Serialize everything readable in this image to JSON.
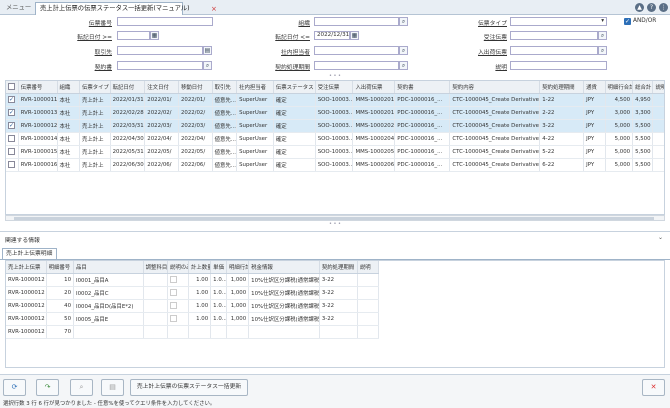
{
  "tabs": {
    "menu": "メニュー",
    "active": "売上計上伝票の伝票ステータス一括更新(マニュアル)",
    "close": "×"
  },
  "top_icons": {
    "up": "▲",
    "help": "?",
    "dots": "⋮"
  },
  "search": {
    "denpyo_no": "伝票番号",
    "soshiki": "組織",
    "denpyo_type": "伝票タイプ",
    "and_or": "AND/OR",
    "date_from_label": "転記日付 >=",
    "date_to_label": "転記日付 <=",
    "date_to_value": "2022/12/31",
    "juchu": "受注伝票",
    "torihikisaki": "取引先",
    "shanai": "社内担当者",
    "nyushukka": "入出荷伝票",
    "keiyakusho": "契約書",
    "keiyaku_kikan": "契約処理期間",
    "setsumei": "説明"
  },
  "grid": {
    "headers": [
      "伝票番号",
      "組織",
      "伝票タイプ",
      "転記日付",
      "注文日付",
      "移動日付",
      "取引先",
      "社内担当者",
      "伝票ステータス",
      "受注伝票",
      "入出荷伝票",
      "契約書",
      "契約内容",
      "契約処理期間",
      "通貨",
      "明細行合計",
      "総合計",
      "説明"
    ],
    "rows": [
      {
        "sel": true,
        "c": [
          "RVR-1000011",
          "本社",
          "売上計上",
          "2022/01/31",
          "2022/01/",
          "2022/01/",
          "値意先...",
          "SuperUser",
          "確定",
          "SOO-10003...",
          "MMS-1000201",
          "PDC-1000016_...",
          "CTC-1000045_Create Derivative...",
          "1-22",
          "JPY",
          "4,500",
          "4,950",
          ""
        ]
      },
      {
        "sel": true,
        "c": [
          "RVR-1000013",
          "本社",
          "売上計上",
          "2022/02/28",
          "2022/02/",
          "2022/02/",
          "値意先...",
          "SuperUser",
          "確定",
          "SOO-10003...",
          "MMS-1000201",
          "PDC-1000016_...",
          "CTC-1000045_Create Derivative...",
          "2-22",
          "JPY",
          "3,000",
          "3,300",
          ""
        ]
      },
      {
        "sel": true,
        "c": [
          "RVR-1000012",
          "本社",
          "売上計上",
          "2022/03/31",
          "2022/03/",
          "2022/03/",
          "値意先...",
          "SuperUser",
          "確定",
          "SOO-10003...",
          "MMS-1000202",
          "PDC-1000016_...",
          "CTC-1000045_Create Derivative...",
          "3-22",
          "JPY",
          "5,000",
          "5,500",
          ""
        ]
      },
      {
        "sel": false,
        "c": [
          "RVR-1000014",
          "本社",
          "売上計上",
          "2022/04/30",
          "2022/04/",
          "2022/04/",
          "値意先...",
          "SuperUser",
          "確定",
          "SOO-10003...",
          "MMS-1000204",
          "PDC-1000016_...",
          "CTC-1000045_Create Derivative...",
          "4-22",
          "JPY",
          "5,000",
          "5,500",
          ""
        ]
      },
      {
        "sel": false,
        "c": [
          "RVR-1000015",
          "本社",
          "売上計上",
          "2022/05/31",
          "2022/05/",
          "2022/05/",
          "値意先...",
          "SuperUser",
          "確定",
          "SOO-10003...",
          "MMS-1000205",
          "PDC-1000016_...",
          "CTC-1000045_Create Derivative...",
          "5-22",
          "JPY",
          "5,000",
          "5,500",
          ""
        ]
      },
      {
        "sel": false,
        "c": [
          "RVR-1000016",
          "本社",
          "売上計上",
          "2022/06/30",
          "2022/06/",
          "2022/06/",
          "値意先...",
          "SuperUser",
          "確定",
          "SOO-10003...",
          "MMS-1000206",
          "PDC-1000016_...",
          "CTC-1000045_Create Derivative...",
          "6-22",
          "JPY",
          "5,000",
          "5,500",
          ""
        ]
      }
    ]
  },
  "related": {
    "title": "関連する情報",
    "collapse": "⌄",
    "tab": "売上計上伝票明細",
    "headers": [
      "売上計上伝票",
      "明細番号",
      "品目",
      "調整科目",
      "説明のみ",
      "計上数量",
      "単価",
      "明細行計",
      "税金情報",
      "契約処理期間",
      "説明"
    ],
    "rows": [
      [
        "RVR-1000012",
        "10",
        "I0001_品目A",
        "",
        "",
        "1.00",
        "1.0...",
        "1,000",
        "10%仕訳区分課税(通常課税)",
        "3-22",
        ""
      ],
      [
        "RVR-1000012",
        "20",
        "I0002_品目C",
        "",
        "",
        "1.00",
        "1.0...",
        "1,000",
        "10%仕訳区分課税(通常課税)",
        "3-22",
        ""
      ],
      [
        "RVR-1000012",
        "40",
        "I0004_品目D(品目E*2)",
        "",
        "",
        "1.00",
        "1.0...",
        "1,000",
        "10%仕訳区分課税(通常課税)",
        "3-22",
        ""
      ],
      [
        "RVR-1000012",
        "50",
        "I0005_品目E",
        "",
        "",
        "1.00",
        "1.0...",
        "1,000",
        "10%仕訳区分課税(通常課税)",
        "3-22",
        ""
      ],
      [
        "RVR-1000012",
        "70",
        "",
        "",
        "",
        "",
        "",
        "",
        "",
        "",
        ""
      ]
    ]
  },
  "footer": {
    "update_button": "売上計上伝票の伝票ステータス一括更新",
    "status": "選択行数 3 行 6 行が見つかりました - 任意%を使ってクエリ条件を入力してください。"
  }
}
